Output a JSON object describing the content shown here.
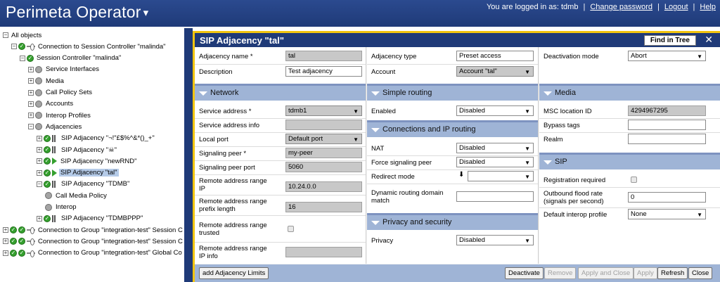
{
  "header": {
    "title": "Perimeta Operator",
    "caret": "▾",
    "logged_in_text": "You are logged in as:",
    "user": "tdmb",
    "links": [
      "Change password",
      "Logout",
      "Help"
    ],
    "separators": [
      "|",
      "|",
      "|"
    ]
  },
  "tree": [
    {
      "label": "All objects",
      "indent": 0,
      "icons": [
        "exp-minus"
      ]
    },
    {
      "label": "Connection to Session Controller \"malinda\"",
      "indent": 1,
      "icons": [
        "exp-minus",
        "check",
        "link"
      ]
    },
    {
      "label": "Session Controller \"malinda\"",
      "indent": 2,
      "icons": [
        "exp-minus",
        "check"
      ]
    },
    {
      "label": "Service Interfaces",
      "indent": 3,
      "icons": [
        "exp-plus",
        "grey"
      ]
    },
    {
      "label": "Media",
      "indent": 3,
      "icons": [
        "exp-plus",
        "grey"
      ]
    },
    {
      "label": "Call Policy Sets",
      "indent": 3,
      "icons": [
        "exp-plus",
        "grey"
      ]
    },
    {
      "label": "Accounts",
      "indent": 3,
      "icons": [
        "exp-plus",
        "grey"
      ]
    },
    {
      "label": "Interop Profiles",
      "indent": 3,
      "icons": [
        "exp-plus",
        "grey"
      ]
    },
    {
      "label": "Adjacencies",
      "indent": 3,
      "icons": [
        "exp-minus",
        "grey"
      ]
    },
    {
      "label": "SIP Adjacency \"¬!\"£$%^&*()_+\"",
      "indent": 4,
      "icons": [
        "exp-plus",
        "check",
        "bars"
      ]
    },
    {
      "label": "SIP Adjacency \"☠\"",
      "indent": 4,
      "icons": [
        "exp-plus",
        "check",
        "bars"
      ]
    },
    {
      "label": "SIP Adjacency \"newRND\"",
      "indent": 4,
      "icons": [
        "exp-plus",
        "check",
        "play"
      ]
    },
    {
      "label": "SIP Adjacency \"tal\"",
      "indent": 4,
      "icons": [
        "exp-plus",
        "check",
        "play"
      ],
      "selected": true
    },
    {
      "label": "SIP Adjacency \"TDMB\"",
      "indent": 4,
      "icons": [
        "exp-minus",
        "check",
        "bars"
      ]
    },
    {
      "label": "Call Media Policy",
      "indent": 5,
      "icons": [
        "grey"
      ]
    },
    {
      "label": "Interop",
      "indent": 5,
      "icons": [
        "grey"
      ]
    },
    {
      "label": "SIP Adjacency \"TDMBPPP\"",
      "indent": 4,
      "icons": [
        "exp-plus",
        "check",
        "bars"
      ]
    },
    {
      "label": "Connection to Group \"integration-test\" Session C",
      "indent": 0,
      "icons": [
        "exp-plus",
        "check",
        "check",
        "link"
      ]
    },
    {
      "label": "Connection to Group \"integration-test\" Session C",
      "indent": 0,
      "icons": [
        "exp-plus",
        "check",
        "check",
        "link"
      ]
    },
    {
      "label": "Connection to Group \"integration-test\" Global Co",
      "indent": 0,
      "icons": [
        "exp-plus",
        "check",
        "check",
        "link"
      ]
    }
  ],
  "panel": {
    "title": "SIP Adjacency \"tal\"",
    "find_in_tree": "Find in Tree",
    "close": "✕"
  },
  "general": {
    "adjacency_name_label": "Adjacency name *",
    "adjacency_name_value": "tal",
    "description_label": "Description",
    "description_value": "Test adjacency",
    "adjacency_type_label": "Adjacency type",
    "adjacency_type_value": "Preset access",
    "account_label": "Account",
    "account_value": "Account \"tal\"",
    "deactivation_mode_label": "Deactivation mode",
    "deactivation_mode_value": "Abort"
  },
  "network": {
    "title": "Network",
    "service_address_label": "Service address *",
    "service_address_value": "tdmb1",
    "service_address_info_label": "Service address info",
    "local_port_label": "Local port",
    "local_port_value": "Default port",
    "signaling_peer_label": "Signaling peer *",
    "signaling_peer_value": "my-peer",
    "signaling_peer_port_label": "Signaling peer port",
    "signaling_peer_port_value": "5060",
    "remote_range_ip_label_1": "Remote address range",
    "remote_range_ip_label_2": "IP",
    "remote_range_ip_value": "10.24.0.0",
    "remote_range_prefix_label_1": "Remote address range",
    "remote_range_prefix_label_2": "prefix length",
    "remote_range_prefix_value": "16",
    "remote_range_trusted_label_1": "Remote address range",
    "remote_range_trusted_label_2": "trusted",
    "remote_range_info_label_1": "Remote address range",
    "remote_range_info_label_2": "IP info"
  },
  "simple_routing": {
    "title": "Simple routing",
    "enabled_label": "Enabled",
    "enabled_value": "Disabled"
  },
  "connections": {
    "title": "Connections and IP routing",
    "nat_label": "NAT",
    "nat_value": "Disabled",
    "force_sig_label": "Force signaling peer",
    "force_sig_value": "Disabled",
    "redirect_label": "Redirect mode",
    "redirect_value": "",
    "dynamic_label_1": "Dynamic routing domain",
    "dynamic_label_2": "match"
  },
  "privacy": {
    "title": "Privacy and security",
    "privacy_label": "Privacy",
    "privacy_value": "Disabled"
  },
  "media": {
    "title": "Media",
    "msc_label": "MSC location ID",
    "msc_value": "4294967295",
    "bypass_label": "Bypass tags",
    "realm_label": "Realm"
  },
  "sip": {
    "title": "SIP",
    "registration_label": "Registration required",
    "flood_label_1": "Outbound flood rate",
    "flood_label_2": "(signals per second)",
    "flood_value": "0",
    "interop_label": "Default interop profile",
    "interop_value": "None"
  },
  "buttons": {
    "add_limits": "add Adjacency Limits",
    "deactivate": "Deactivate",
    "remove": "Remove",
    "apply_close": "Apply and Close",
    "apply": "Apply",
    "refresh": "Refresh",
    "close": "Close"
  },
  "colors": {
    "header_bg": "#1f3a78",
    "section_bg": "#9fb4d6",
    "panel_border": "#f1c40f",
    "status_green": "#35a02e",
    "selected_bg": "#b5cbe8"
  }
}
